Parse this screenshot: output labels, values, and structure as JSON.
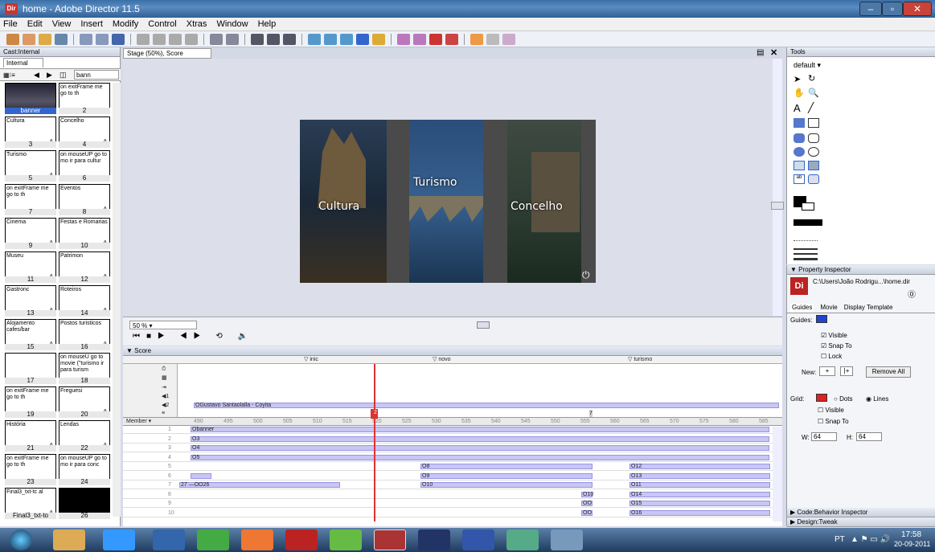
{
  "window": {
    "title": "home - Adobe Director 11.5",
    "app_badge": "Dir"
  },
  "menu": [
    "File",
    "Edit",
    "View",
    "Insert",
    "Modify",
    "Control",
    "Xtras",
    "Window",
    "Help"
  ],
  "cast": {
    "header": "Cast:Internal",
    "tab": "Internal",
    "search": "bann",
    "members": [
      {
        "n": "1",
        "label": "",
        "thumb": "banner-image"
      },
      {
        "n": "2",
        "label": "on exitFrame me go to th"
      },
      {
        "n": "3",
        "label": "Cultura"
      },
      {
        "n": "4",
        "label": "Concelho"
      },
      {
        "n": "5",
        "label": "Turismo"
      },
      {
        "n": "6",
        "label": "on mouseUP go to mo ir para cultur"
      },
      {
        "n": "7",
        "label": "on exitFrame me go to th"
      },
      {
        "n": "8",
        "label": "Eventos"
      },
      {
        "n": "9",
        "label": "Cinema"
      },
      {
        "n": "10",
        "label": "Festas e Romarias"
      },
      {
        "n": "11",
        "label": "Museu"
      },
      {
        "n": "12",
        "label": "Patrimon"
      },
      {
        "n": "13",
        "label": "Gastronc"
      },
      {
        "n": "14",
        "label": "Roteiros"
      },
      {
        "n": "15",
        "label": "Alojamento cafes/bar"
      },
      {
        "n": "16",
        "label": "Postos turisticos"
      },
      {
        "n": "17",
        "label": ""
      },
      {
        "n": "18",
        "label": "on mouseU go to movie (\"turismo ir para turism"
      },
      {
        "n": "19",
        "label": "on exitFrame me go to th"
      },
      {
        "n": "20",
        "label": "Freguesi"
      },
      {
        "n": "21",
        "label": "História"
      },
      {
        "n": "22",
        "label": "Lendas"
      },
      {
        "n": "23",
        "label": "on exitFrame me go to th"
      },
      {
        "n": "24",
        "label": "on mouseUP go to mo ir para conc"
      },
      {
        "n": "25",
        "label": "Final3_txt-tc al"
      },
      {
        "n": "26",
        "label": ""
      }
    ],
    "banner_caption": "banner",
    "last_caption": "Final3_txt-to"
  },
  "stage": {
    "tab": "Stage (50%), Score",
    "zoom": "50 %",
    "labels": [
      "Cultura",
      "Turismo",
      "Concelho"
    ]
  },
  "score": {
    "header": "Score",
    "member_label": "Member",
    "markers": [
      "inic",
      "novo",
      "turismo"
    ],
    "frame_ticks": [
      "490",
      "495",
      "500",
      "505",
      "510",
      "515",
      "520",
      "525",
      "530",
      "535",
      "540",
      "545",
      "550",
      "555",
      "560",
      "565",
      "570",
      "575",
      "580",
      "585"
    ],
    "sound_track": "OGustavo Santaolalla - Coyita",
    "playhead_frame": "2",
    "marker_7": "7",
    "channels": [
      {
        "n": "1",
        "text": "Obanner"
      },
      {
        "n": "2",
        "text": "O3"
      },
      {
        "n": "3",
        "text": "O4"
      },
      {
        "n": "4",
        "text": "O5"
      },
      {
        "n": "5",
        "text": "O8",
        "text2": "O12"
      },
      {
        "n": "6",
        "text": "O9",
        "text2": "O13"
      },
      {
        "n": "7",
        "text": "27 —OO26",
        "text1": "O10",
        "text2": "O11"
      },
      {
        "n": "8",
        "text": "O10",
        "text2": "O14"
      },
      {
        "n": "9",
        "text": "OO",
        "text2": "O15"
      },
      {
        "n": "10",
        "text": "OO",
        "text2": "O16"
      }
    ]
  },
  "tools": {
    "header": "Tools",
    "mode": "default"
  },
  "property": {
    "header": "Property Inspector",
    "path": "C:\\Users\\João Rodrigu...\\home.dir",
    "tabs": [
      "Guides",
      "Movie",
      "Display Template"
    ],
    "guides_label": "Guides:",
    "visible": "Visible",
    "snap": "Snap To",
    "lock": "Lock",
    "new": "New:",
    "remove": "Remove All",
    "grid": "Grid:",
    "dots": "Dots",
    "lines": "Lines",
    "grid_visible": "Visible",
    "grid_snap": "Snap To",
    "w_label": "W:",
    "w": "64",
    "h_label": "H:",
    "h": "64",
    "bottom1": "Code:Behavior Inspector",
    "bottom2": "Design:Tweak"
  },
  "taskbar": {
    "lang": "PT",
    "time": "17:58",
    "date": "20-09-2011"
  }
}
